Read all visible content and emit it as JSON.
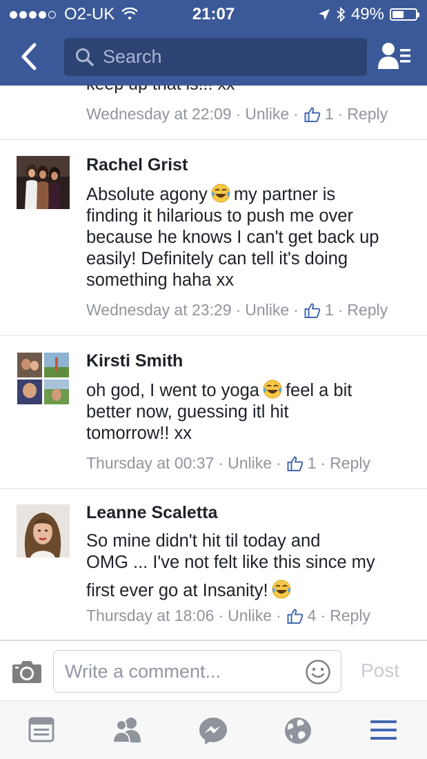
{
  "status_bar": {
    "carrier": "O2-UK",
    "time": "21:07",
    "battery": "49%",
    "battery_level": 0.49
  },
  "header": {
    "search": {
      "placeholder": "Search"
    },
    "icons": [
      "chevron-left-icon",
      "search-icon",
      "friend-requests-icon"
    ]
  },
  "comments": [
    {
      "author": "",
      "text": "keep up that is!!! xx",
      "time": "Wednesday at 22:09",
      "unlike": "Unlike",
      "likes": "1",
      "reply": "Reply"
    },
    {
      "author": "Rachel Grist",
      "text_lines": [
        "Absolute agony",
        "my partner is",
        "finding it hilarious to push me over",
        "because he knows I can't get back up",
        "easily! Definitely can tell it's doing",
        "something haha xx"
      ],
      "time": "Wednesday at 23:29",
      "unlike": "Unlike",
      "likes": "1",
      "reply": "Reply"
    },
    {
      "author": "Kirsti Smith",
      "text_lines": [
        "oh god, I went to yoga",
        "feel a bit",
        "better now, guessing itl hit",
        "tomorrow!! xx"
      ],
      "time": "Thursday at 00:37",
      "unlike": "Unlike",
      "likes": "1",
      "reply": "Reply"
    },
    {
      "author": "Leanne Scaletta",
      "text_lines": [
        "So mine didn't hit til today and",
        "OMG ... I've not felt like this since my",
        "first ever go at Insanity!"
      ],
      "time": "Thursday at 18:06",
      "unlike": "Unlike",
      "likes": "4",
      "reply": "Reply"
    }
  ],
  "composer": {
    "placeholder": "Write a comment...",
    "post_label": "Post"
  },
  "bottom_nav": {
    "items": [
      "news-feed-icon",
      "friends-icon",
      "messenger-icon",
      "notifications-globe-icon",
      "menu-icon"
    ],
    "active": "menu-icon"
  },
  "colors": {
    "brand": "#3b5998",
    "search_bg": "#2d4373",
    "meta_text": "#90949c",
    "like_blue": "#4267b2",
    "divider": "#dddfe2"
  }
}
